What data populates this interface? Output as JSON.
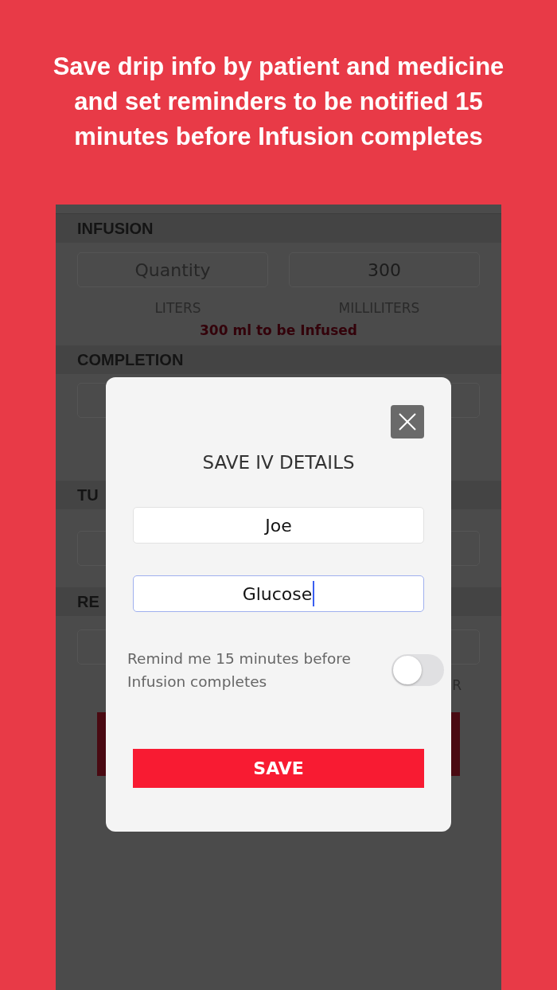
{
  "headline": "Save drip info by patient and medicine and set reminders to be notified 15 minutes before Infusion completes",
  "background": {
    "infusion": {
      "title": "INFUSION",
      "quantity_placeholder": "Quantity",
      "milliliters_value": "300",
      "units": [
        "LITERS",
        "MILLILITERS"
      ],
      "note": "300 ml to be Infused"
    },
    "completion_title": "COMPLETION",
    "section_3_title": "TU",
    "section_4_title": "RE",
    "section_4_unit": "R"
  },
  "modal": {
    "title": "SAVE IV DETAILS",
    "fields": [
      {
        "value": "Joe",
        "focused": false
      },
      {
        "value": "Glucose",
        "focused": true
      }
    ],
    "reminder": {
      "label": "Remind me 15 minutes before Infusion completes",
      "on": false
    },
    "save_button": "SAVE"
  }
}
